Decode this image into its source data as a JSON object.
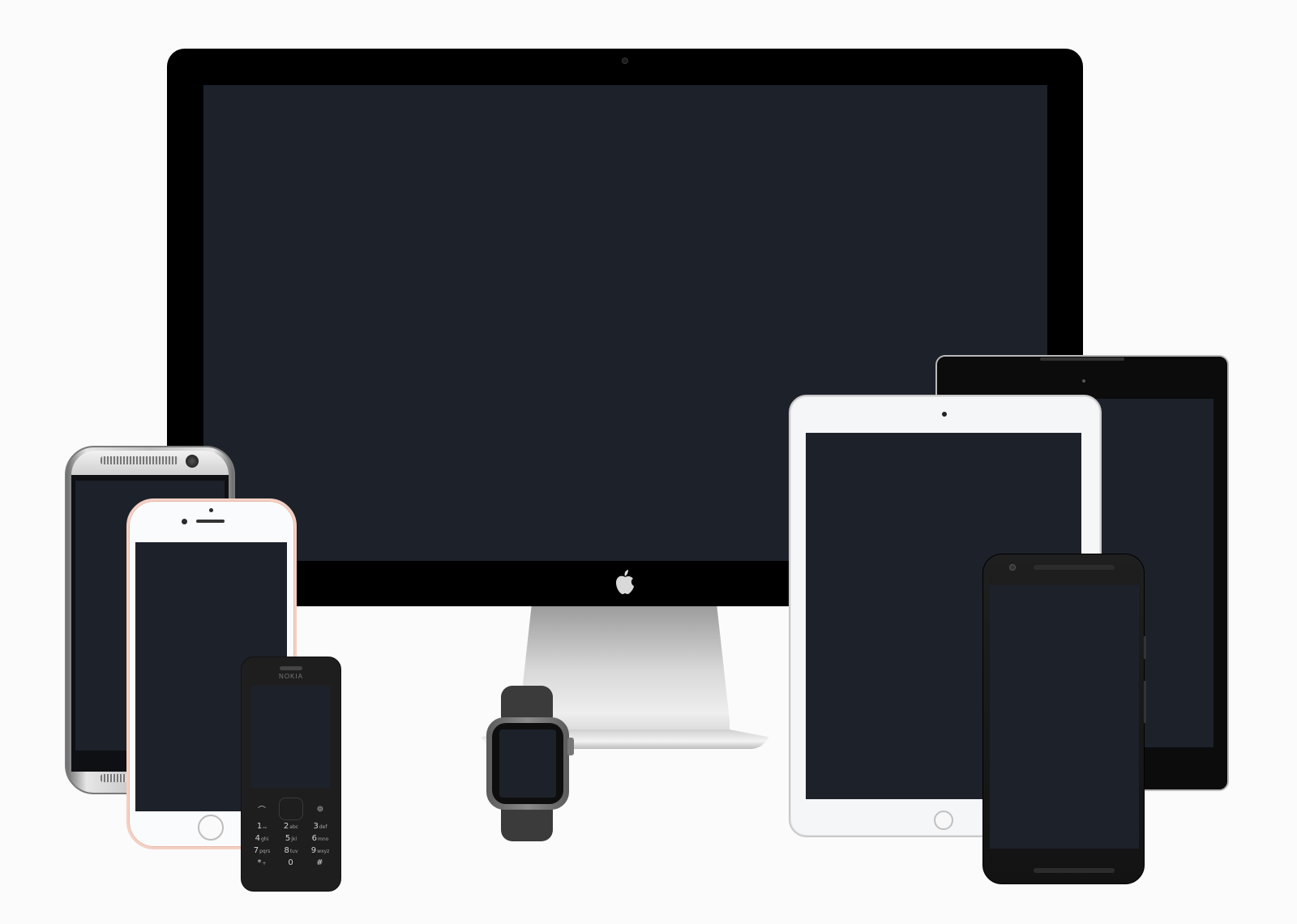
{
  "background": "#fbfbfb",
  "screen_color": "#1d212a",
  "devices": [
    {
      "name": "desktop-display",
      "color": "black"
    },
    {
      "name": "htc-one",
      "color": "silver"
    },
    {
      "name": "iphone",
      "color": "rose-gold"
    },
    {
      "name": "feature-phone",
      "color": "black"
    },
    {
      "name": "smartwatch",
      "color": "space-gray"
    },
    {
      "name": "android-tablet",
      "color": "black"
    },
    {
      "name": "ipad",
      "color": "white"
    },
    {
      "name": "android-phone",
      "color": "black"
    }
  ],
  "nokia": {
    "brand": "NOKIA",
    "keys": [
      {
        "digit": "1",
        "letters": "ₒₒ"
      },
      {
        "digit": "2",
        "letters": "abc"
      },
      {
        "digit": "3",
        "letters": "def"
      },
      {
        "digit": "4",
        "letters": "ghi"
      },
      {
        "digit": "5",
        "letters": "jkl"
      },
      {
        "digit": "6",
        "letters": "mno"
      },
      {
        "digit": "7",
        "letters": "pqrs"
      },
      {
        "digit": "8",
        "letters": "tuv"
      },
      {
        "digit": "9",
        "letters": "wxyz"
      },
      {
        "digit": "*",
        "letters": "+"
      },
      {
        "digit": "0",
        "letters": ""
      },
      {
        "digit": "#",
        "letters": ""
      }
    ]
  },
  "icons": [
    "apple-logo-icon"
  ]
}
